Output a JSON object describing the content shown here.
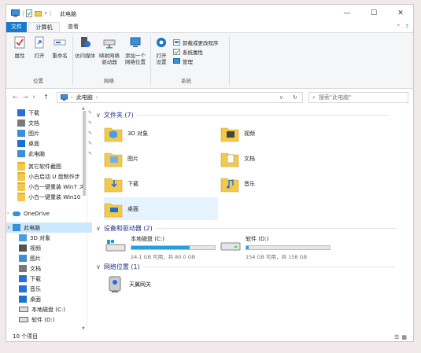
{
  "window": {
    "title": "此电脑"
  },
  "tabs": [
    {
      "label": "文件"
    },
    {
      "label": "计算机"
    },
    {
      "label": "查看"
    }
  ],
  "ribbon": {
    "location": {
      "properties": "属性",
      "open": "打开",
      "rename": "重命名",
      "group": "位置"
    },
    "network": {
      "access_media": "访问媒体",
      "map_drive": "映射网络驱动器",
      "add_location": "添加一个网络位置",
      "group": "网络"
    },
    "system": {
      "open_settings": "打开设置",
      "uninstall": "卸载或更改程序",
      "sys_props": "系统属性",
      "manage": "管理",
      "group": "系统"
    }
  },
  "address": {
    "path": "此电脑",
    "search_placeholder": "搜索\"此电脑\""
  },
  "nav": {
    "items": [
      {
        "label": "下载",
        "icon": "download-icon",
        "color": "#2a6fd6",
        "pinned": true
      },
      {
        "label": "文档",
        "icon": "document-icon",
        "color": "#7a7a7a",
        "pinned": true
      },
      {
        "label": "图片",
        "icon": "picture-icon",
        "color": "#3a8fd9",
        "pinned": true
      },
      {
        "label": "桌面",
        "icon": "desktop-icon",
        "color": "#1a73c9",
        "pinned": true
      },
      {
        "label": "此电脑",
        "icon": "computer-icon",
        "color": "#3a8fd9",
        "pinned": true
      },
      {
        "label": "其它软件截图",
        "icon": "folder-icon",
        "color": "#f3c94d",
        "pinned": false
      },
      {
        "label": "小白启动 U 盘制作步",
        "icon": "folder-icon",
        "color": "#f3c94d",
        "pinned": false
      },
      {
        "label": "小白一键重装 Win7 ス",
        "icon": "folder-icon",
        "color": "#f3c94d",
        "pinned": false
      },
      {
        "label": "小白一键重装 Win10",
        "icon": "folder-icon",
        "color": "#f3c94d",
        "pinned": false
      },
      {
        "label": "OneDrive",
        "icon": "onedrive-icon",
        "color": "#3a8fd9",
        "pinned": false
      },
      {
        "label": "此电脑",
        "icon": "computer-icon",
        "color": "#3a8fd9",
        "pinned": false
      },
      {
        "label": "3D 对象",
        "icon": "3d-objects-icon",
        "color": "#4a9ee0",
        "pinned": false
      },
      {
        "label": "视频",
        "icon": "video-icon",
        "color": "#555555",
        "pinned": false
      },
      {
        "label": "图片",
        "icon": "picture-icon",
        "color": "#3a8fd9",
        "pinned": false
      },
      {
        "label": "文档",
        "icon": "document-icon",
        "color": "#7a7a7a",
        "pinned": false
      },
      {
        "label": "下载",
        "icon": "download-icon",
        "color": "#2a6fd6",
        "pinned": false
      },
      {
        "label": "音乐",
        "icon": "music-icon",
        "color": "#2a6fd6",
        "pinned": false
      },
      {
        "label": "桌面",
        "icon": "desktop-icon",
        "color": "#1a73c9",
        "pinned": false
      },
      {
        "label": "本地磁盘 (C:)",
        "icon": "drive-icon",
        "color": "#888888",
        "pinned": false
      },
      {
        "label": "软件 (D:)",
        "icon": "drive-icon",
        "color": "#888888",
        "pinned": false
      }
    ]
  },
  "content": {
    "folders_header": "文件夹 (7)",
    "folders": [
      {
        "label": "3D 对象",
        "icon": "3d-objects-folder-icon"
      },
      {
        "label": "视频",
        "icon": "video-folder-icon"
      },
      {
        "label": "图片",
        "icon": "picture-folder-icon"
      },
      {
        "label": "文档",
        "icon": "document-folder-icon"
      },
      {
        "label": "下载",
        "icon": "download-folder-icon"
      },
      {
        "label": "音乐",
        "icon": "music-folder-icon"
      },
      {
        "label": "桌面",
        "icon": "desktop-folder-icon"
      }
    ],
    "drives_header": "设备和驱动器 (2)",
    "drives": [
      {
        "name": "本地磁盘 (C:)",
        "info": "24.1 GB 可用，共 80.0 GB",
        "used_fraction": 0.7,
        "fill_color": "#26a0da"
      },
      {
        "name": "软件 (D:)",
        "info": "154 GB 可用，共 158 GB",
        "used_fraction": 0.025,
        "fill_color": "#26a0da"
      }
    ],
    "network_header": "网络位置 (1)",
    "network_items": [
      {
        "label": "天翼网关",
        "icon": "router-icon"
      }
    ]
  },
  "status": {
    "item_count": "10 个项目"
  },
  "colors": {
    "accent": "#1979ca",
    "selection": "#cce8ff",
    "folder": "#f3c94d",
    "header_text": "#1e3287"
  }
}
